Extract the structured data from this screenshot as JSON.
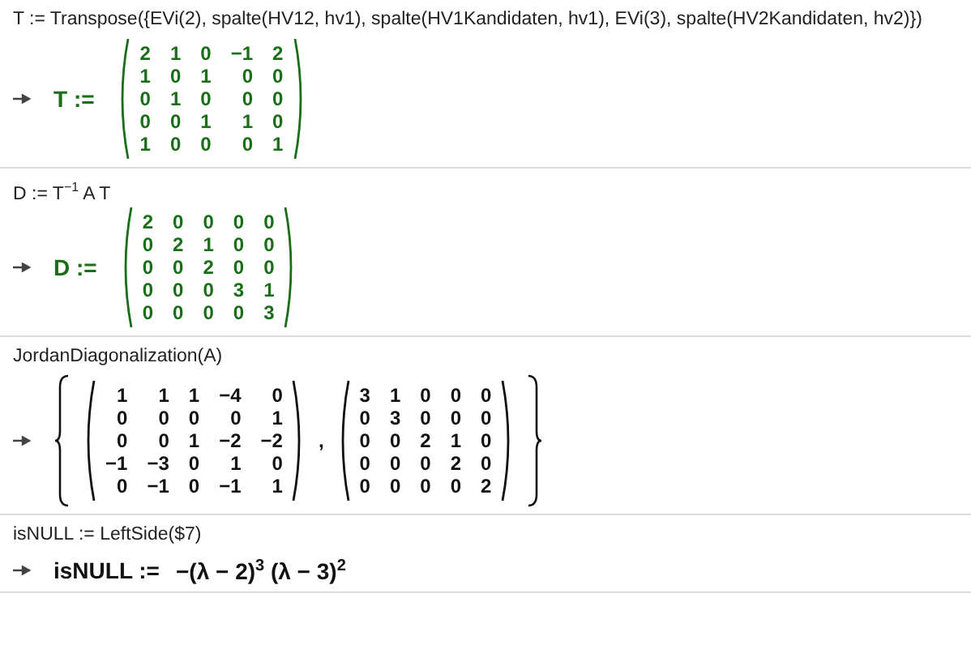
{
  "cells": [
    {
      "input": "T := Transpose({EVi(2), spalte(HV12, hv1), spalte(HV1Kandidaten, hv1), EVi(3), spalte(HV2Kandidaten, hv2)})",
      "output": {
        "kind": "matrix",
        "label": "T :=",
        "color": "#1a6e1a",
        "rows": [
          [
            "2",
            "1",
            "0",
            "−1",
            "2"
          ],
          [
            "1",
            "0",
            "1",
            "0",
            "0"
          ],
          [
            "0",
            "1",
            "0",
            "0",
            "0"
          ],
          [
            "0",
            "0",
            "1",
            "1",
            "0"
          ],
          [
            "1",
            "0",
            "0",
            "0",
            "1"
          ]
        ]
      }
    },
    {
      "input": "D := T$^{−1}$ A T",
      "output": {
        "kind": "matrix",
        "label": "D :=",
        "color": "#1a6e1a",
        "rows": [
          [
            "2",
            "0",
            "0",
            "0",
            "0"
          ],
          [
            "0",
            "2",
            "1",
            "0",
            "0"
          ],
          [
            "0",
            "0",
            "2",
            "0",
            "0"
          ],
          [
            "0",
            "0",
            "0",
            "3",
            "1"
          ],
          [
            "0",
            "0",
            "0",
            "0",
            "3"
          ]
        ]
      }
    },
    {
      "input": "JordanDiagonalization(A)",
      "output": {
        "kind": "list",
        "color": "#111111",
        "separator": ",",
        "matrices": [
          [
            [
              "1",
              "1",
              "1",
              "−4",
              "0"
            ],
            [
              "0",
              "0",
              "0",
              "0",
              "1"
            ],
            [
              "0",
              "0",
              "1",
              "−2",
              "−2"
            ],
            [
              "−1",
              "−3",
              "0",
              "1",
              "0"
            ],
            [
              "0",
              "−1",
              "0",
              "−1",
              "1"
            ]
          ],
          [
            [
              "3",
              "1",
              "0",
              "0",
              "0"
            ],
            [
              "0",
              "3",
              "0",
              "0",
              "0"
            ],
            [
              "0",
              "0",
              "2",
              "1",
              "0"
            ],
            [
              "0",
              "0",
              "0",
              "2",
              "0"
            ],
            [
              "0",
              "0",
              "0",
              "0",
              "2"
            ]
          ]
        ]
      }
    },
    {
      "input": "isNULL := LeftSide($7)",
      "output": {
        "kind": "expression",
        "label": "isNULL :=",
        "color": "#111111",
        "text": "−(λ − 2)$^{3}$ (λ − 3)$^{2}$"
      }
    }
  ]
}
